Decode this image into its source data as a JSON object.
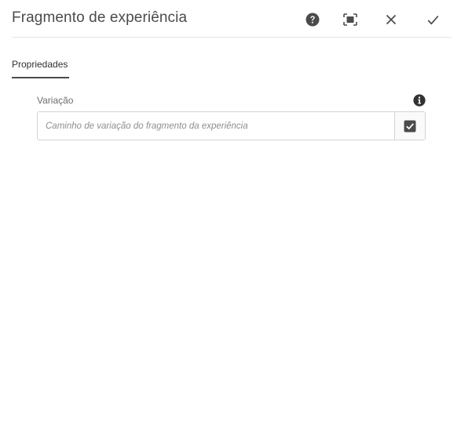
{
  "dialog": {
    "title": "Fragmento de experiência",
    "actions": {
      "help_icon": "help-circle-icon",
      "fullscreen_icon": "fullscreen-icon",
      "close_icon": "close-icon",
      "done_icon": "checkmark-icon"
    }
  },
  "tabs": [
    {
      "label": "Propriedades",
      "active": true
    }
  ],
  "fields": {
    "variation": {
      "label": "Variação",
      "placeholder": "Caminho de variação do fragmento da experiência",
      "value": "",
      "info_icon": "info-circle-icon",
      "picker_icon": "checkbox-checked-icon"
    }
  },
  "colors": {
    "text": "#4b4b4b",
    "icon": "#4b4b4b",
    "border": "#d3d3d3",
    "tab_underline": "#4b4b4b"
  }
}
